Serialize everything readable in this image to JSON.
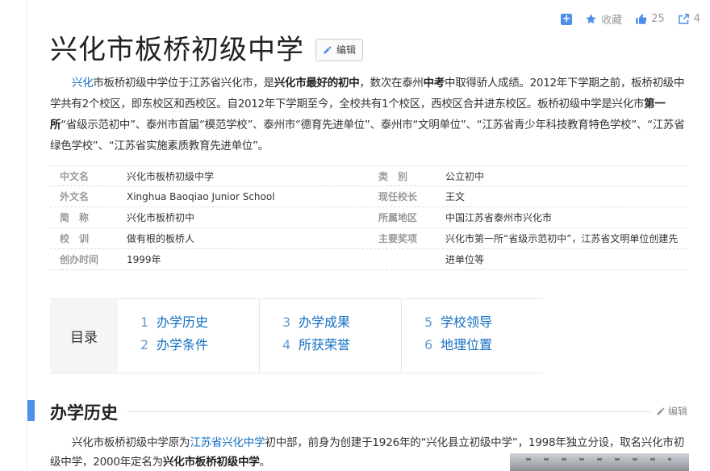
{
  "actions": {
    "favorite_label": "收藏",
    "like_count": "25",
    "share_count": "4"
  },
  "title": "兴化市板桥初级中学",
  "edit_label": "编辑",
  "summary": {
    "s1": "兴化",
    "s2": "市板桥初级中学位于江苏省兴化市，是",
    "s3": "兴化市最好的初中",
    "s4": "，数次在泰州",
    "s5": "中考",
    "s6": "中取得骄人成绩。2012年下学期之前，板桥初级中学共有2个校区，即东校区和西校区。自2012年下学期至今，全校共有1个校区，西校区合并进东校区。板桥初级中学是兴化市",
    "s7": "第一所",
    "s8": "“省级示范初中”、泰州市首届“模范学校”、泰州市“德育先进单位”、泰州市“文明单位”、“江苏省青少年科技教育特色学校”、“江苏省绿色学校”、“江苏省实施素质教育先进单位”。"
  },
  "info": [
    {
      "k1": "中文名",
      "v1": "兴化市板桥初级中学",
      "k2": "类　别",
      "v2": "公立初中"
    },
    {
      "k1": "外文名",
      "v1": "Xinghua Baoqiao Junior School",
      "k2": "现任校长",
      "v2": "王文"
    },
    {
      "k1": "简　称",
      "v1": "兴化市板桥初中",
      "k2": "所属地区",
      "v2": "中国江苏省泰州市兴化市"
    },
    {
      "k1": "校　训",
      "v1": "做有根的板桥人",
      "k2": "主要奖项",
      "v2": "兴化市第一所“省级示范初中”，江苏省文明单位创建先"
    },
    {
      "k1": "创办时间",
      "v1": "1999年",
      "k2": "",
      "v2": "进单位等"
    }
  ],
  "toc": {
    "label": "目录",
    "items": [
      {
        "num": "1",
        "label": "办学历史"
      },
      {
        "num": "2",
        "label": "办学条件"
      },
      {
        "num": "3",
        "label": "办学成果"
      },
      {
        "num": "4",
        "label": "所获荣誉"
      },
      {
        "num": "5",
        "label": "学校领导"
      },
      {
        "num": "6",
        "label": "地理位置"
      }
    ]
  },
  "section": {
    "title": "办学历史",
    "edit_label": "编辑",
    "p1": "兴化市板桥初级中学原为",
    "p2": "江苏省兴化中学",
    "p3": "初中部，前身为创建于1926年的“兴化县立初级中学”，1998年独立分设，取名兴化市初级中学，2000年定名为",
    "p4": "兴化市板桥初级中学",
    "p5": "。"
  }
}
